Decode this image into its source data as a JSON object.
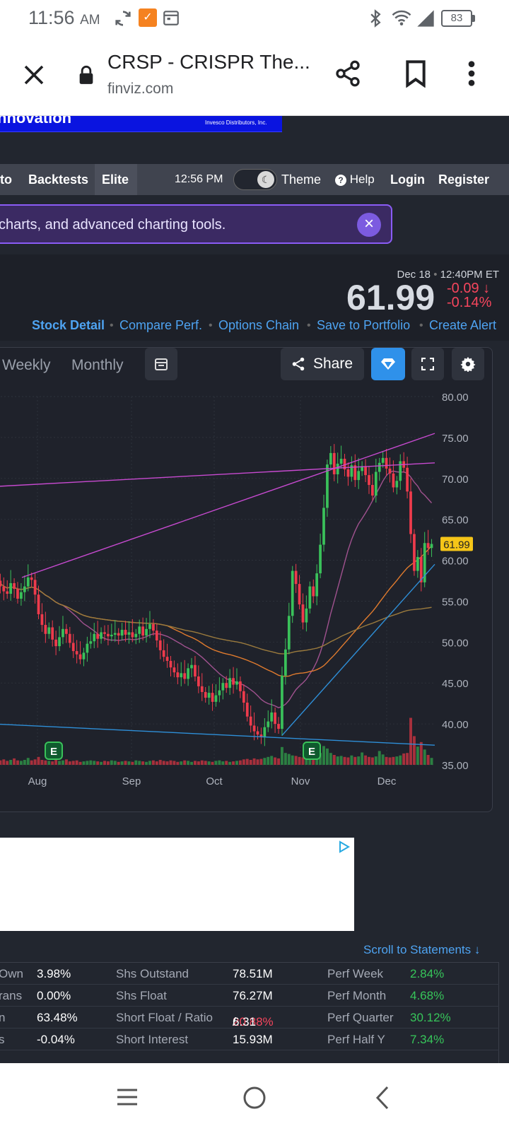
{
  "status": {
    "time": "11:56",
    "ampm": "AM",
    "battery": "83"
  },
  "browser": {
    "title": "CRSP - CRISPR The...",
    "url": "finviz.com"
  },
  "banner": {
    "text": "nnovation",
    "sub": "Invesco Distributors, Inc."
  },
  "nav": {
    "items": [
      "to",
      "Backtests",
      "Elite"
    ],
    "clock": "12:56 PM",
    "theme": "Theme",
    "help": "Help",
    "login": "Login",
    "register": "Register"
  },
  "promo": {
    "text": "charts, and advanced charting tools."
  },
  "quote": {
    "date": "Dec 18",
    "time": "12:40PM ET",
    "price": "61.99",
    "change": "-0.09",
    "change_pct": "-0.14",
    "links": [
      "Stock Detail",
      "Compare Perf.",
      "Options Chain",
      "Save to Portfolio",
      "Create Alert"
    ]
  },
  "toolbar": {
    "weekly": "Weekly",
    "monthly": "Monthly",
    "share": "Share"
  },
  "chart_data": {
    "type": "candlestick",
    "x_ticks": [
      "Aug",
      "Sep",
      "Oct",
      "Nov",
      "Dec"
    ],
    "y_ticks": [
      "80.00",
      "75.00",
      "70.00",
      "65.00",
      "60.00",
      "55.00",
      "50.00",
      "45.00",
      "40.00",
      "35.00"
    ],
    "ylim": [
      35,
      80
    ],
    "last_price_label": "61.99",
    "earnings_marker": "E",
    "closes": [
      57.5,
      56.8,
      56.2,
      55.9,
      57.2,
      56.5,
      55.3,
      56.1,
      56.8,
      57.9,
      57.6,
      55.8,
      53.4,
      52.1,
      51.0,
      51.8,
      50.3,
      49.5,
      50.6,
      51.6,
      51.0,
      49.9,
      48.9,
      48.5,
      47.9,
      48.7,
      49.8,
      50.1,
      51.0,
      50.4,
      51.2,
      51.0,
      50.7,
      50.9,
      51.1,
      50.8,
      51.5,
      50.9,
      51.2,
      50.6,
      51.0,
      51.9,
      50.8,
      51.6,
      52.2,
      51.4,
      50.2,
      49.0,
      48.2,
      47.7,
      46.9,
      46.3,
      45.7,
      46.2,
      45.5,
      46.8,
      47.2,
      45.8,
      44.6,
      43.9,
      43.2,
      43.8,
      42.7,
      43.5,
      44.1,
      45.0,
      44.4,
      45.6,
      44.8,
      45.2,
      44.0,
      42.6,
      40.9,
      39.8,
      39.1,
      38.7,
      38.4,
      39.6,
      40.3,
      41.4,
      40.0,
      39.4,
      45.9,
      49.1,
      53.2,
      58.7,
      57.1,
      54.6,
      52.4,
      54.1,
      56.8,
      55.6,
      58.4,
      61.9,
      66.4,
      71.7,
      73.1,
      70.5,
      71.8,
      72.4,
      71.1,
      70.2,
      71.6,
      69.8,
      70.9,
      71.5,
      70.4,
      69.2,
      67.9,
      70.8,
      71.9,
      72.5,
      71.2,
      70.6,
      68.9,
      69.7,
      72.1,
      71.3,
      68.4,
      63.2,
      58.7,
      60.4,
      57.3,
      62.1,
      61.5,
      61.99
    ],
    "volumes": [
      1.2,
      0.9,
      1.1,
      0.8,
      1.0,
      1.3,
      0.9,
      0.8,
      1.0,
      1.4,
      0.9,
      1.1,
      1.6,
      1.0,
      0.9,
      0.8,
      0.7,
      1.0,
      0.8,
      0.9,
      1.1,
      0.7,
      0.8,
      0.9,
      0.6,
      0.7,
      0.8,
      0.9,
      0.8,
      0.7,
      0.6,
      0.8,
      0.7,
      0.9,
      0.8,
      0.6,
      0.7,
      0.8,
      0.7,
      0.6,
      0.9,
      0.8,
      0.7,
      0.6,
      0.8,
      0.9,
      0.7,
      1.0,
      0.8,
      0.7,
      0.9,
      0.8,
      0.6,
      0.7,
      0.9,
      0.8,
      0.6,
      0.8,
      0.7,
      0.9,
      0.8,
      0.7,
      0.6,
      0.8,
      0.9,
      0.7,
      0.8,
      0.6,
      0.7,
      0.8,
      0.9,
      1.1,
      1.2,
      1.0,
      1.3,
      1.1,
      1.2,
      1.4,
      1.6,
      1.8,
      1.5,
      1.3,
      3.6,
      2.4,
      2.2,
      1.9,
      1.8,
      1.6,
      1.5,
      1.7,
      2.2,
      1.8,
      2.6,
      2.4,
      3.8,
      3.3,
      2.4,
      2.0,
      1.7,
      1.8,
      1.6,
      1.5,
      1.9,
      1.6,
      1.7,
      2.5,
      1.9,
      1.6,
      1.5,
      1.7,
      2.8,
      2.1,
      1.6,
      1.5,
      1.6,
      1.7,
      1.9,
      2.3,
      2.4,
      9.5,
      5.8,
      3.7,
      4.6,
      3.1,
      2.0,
      1.4
    ]
  },
  "stats": {
    "scroll_link": "Scroll to Statements ↓",
    "rows": [
      [
        "Own",
        "3.98%",
        "Shs Outstand",
        "78.51M",
        "Perf Week",
        "2.84%"
      ],
      [
        "rans",
        "0.00%",
        "Shs Float",
        "76.27M",
        "Perf Month",
        "4.68%"
      ],
      [
        "n",
        "63.48%",
        "Short Float / Ratio",
        "20.88%",
        "Perf Quarter",
        "30.12%"
      ],
      [
        "s",
        "-0.04%",
        "Short Interest",
        "15.93M",
        "Perf Half Y",
        "7.34%"
      ]
    ],
    "short_ratio": "6.31"
  }
}
